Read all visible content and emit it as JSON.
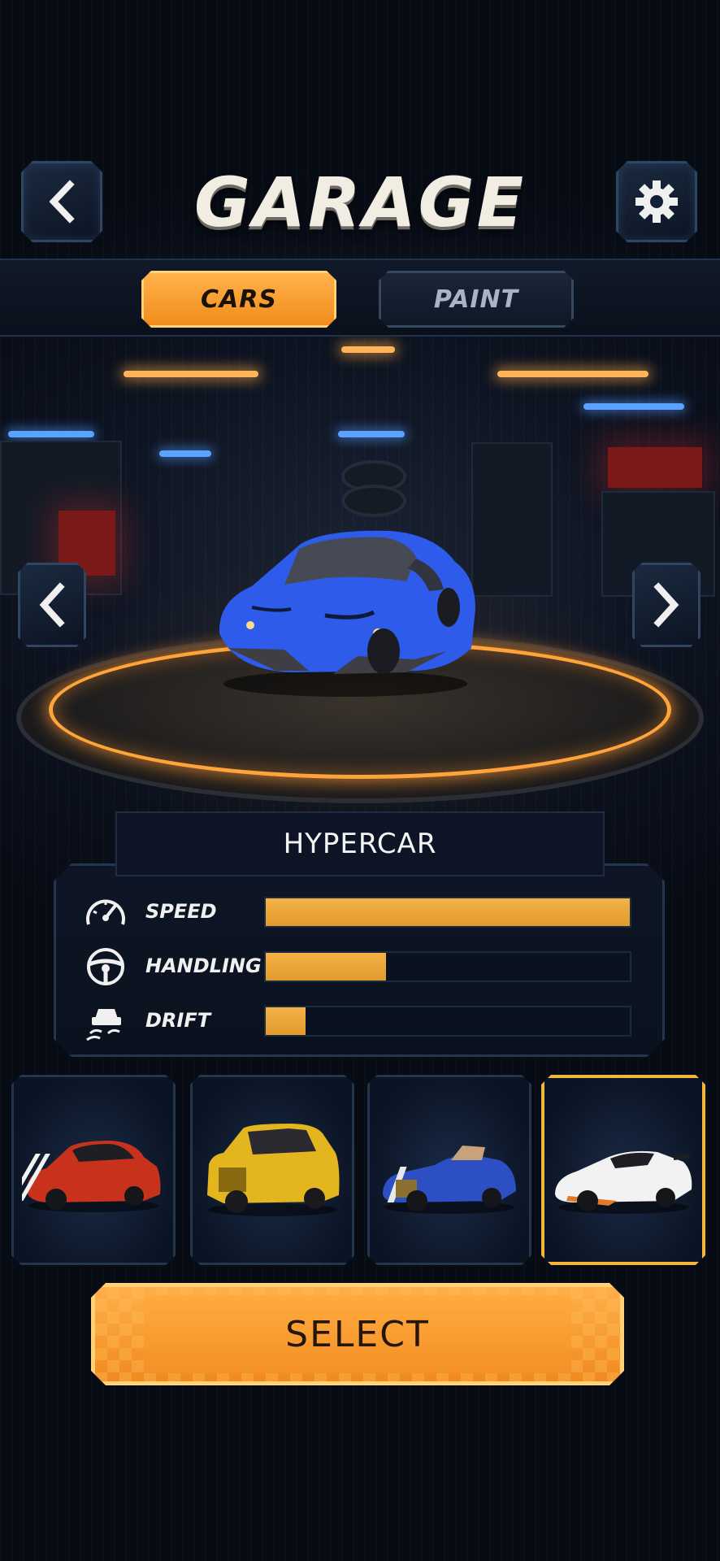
{
  "header": {
    "title": "GARAGE",
    "back_icon": "chevron-left-icon",
    "settings_icon": "gear-icon"
  },
  "tabs": [
    {
      "label": "CARS",
      "active": true
    },
    {
      "label": "PAINT",
      "active": false
    }
  ],
  "showcase": {
    "prev_icon": "chevron-left-icon",
    "next_icon": "chevron-right-icon",
    "car_color": "#2f5bea"
  },
  "car": {
    "name": "HYPERCAR",
    "stats": [
      {
        "label": "SPEED",
        "icon": "speedometer-icon",
        "value": 1.0
      },
      {
        "label": "HANDLING",
        "icon": "steering-wheel-icon",
        "value": 0.33
      },
      {
        "label": "DRIFT",
        "icon": "drift-icon",
        "value": 0.11
      }
    ]
  },
  "car_selector": [
    {
      "color": "#c8321c",
      "selected": false
    },
    {
      "color": "#e3b51e",
      "selected": false
    },
    {
      "color": "#2c4fc4",
      "selected": false
    },
    {
      "color": "#f2f2f2",
      "selected": true
    }
  ],
  "select_button": {
    "label": "SELECT"
  },
  "colors": {
    "accent": "#f4a233",
    "panel": "#0d1426",
    "border": "#24354e"
  }
}
